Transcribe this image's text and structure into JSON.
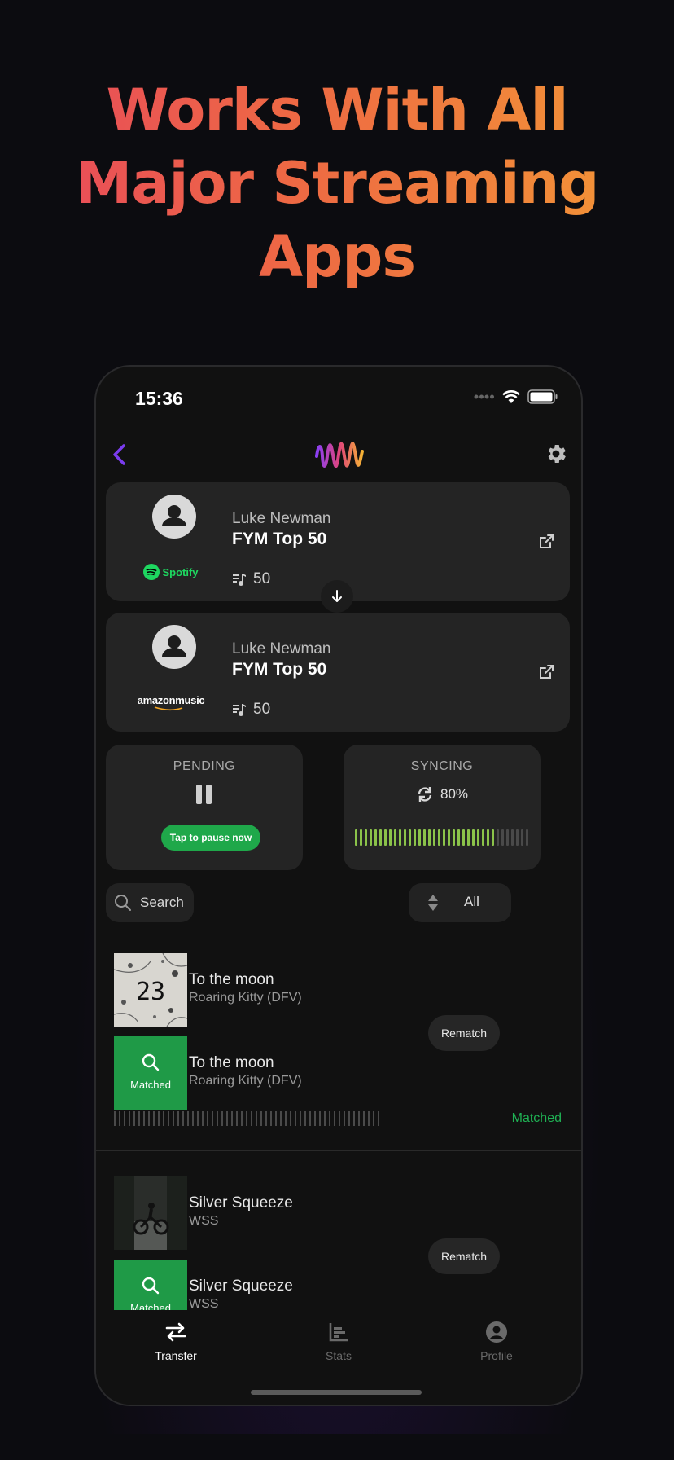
{
  "headline": [
    "Works With All",
    "Major Streaming",
    "Apps"
  ],
  "status_bar": {
    "time": "15:36"
  },
  "source": {
    "owner": "Luke Newman",
    "playlist": "FYM Top 50",
    "count": "50",
    "service": "Spotify"
  },
  "destination": {
    "owner": "Luke Newman",
    "playlist": "FYM Top 50",
    "count": "50",
    "service": "amazonmusic"
  },
  "pending": {
    "title": "PENDING",
    "button": "Tap to pause now"
  },
  "syncing": {
    "title": "SYNCING",
    "percent": "80%",
    "progress": 0.8
  },
  "search": {
    "placeholder": "Search"
  },
  "filter": {
    "label": "All"
  },
  "tracks": [
    {
      "original": {
        "title": "To the moon",
        "artist": "Roaring Kitty (DFV)",
        "art_text": "23"
      },
      "matched": {
        "title": "To the moon",
        "artist": "Roaring Kitty (DFV)",
        "badge": "Matched"
      },
      "rematch": "Rematch",
      "status": "Matched"
    },
    {
      "original": {
        "title": "Silver Squeeze",
        "artist": "WSS"
      },
      "matched": {
        "title": "Silver Squeeze",
        "artist": "WSS",
        "badge": "Matched"
      },
      "rematch": "Rematch"
    }
  ],
  "tabs": [
    {
      "label": "Transfer",
      "active": true
    },
    {
      "label": "Stats",
      "active": false
    },
    {
      "label": "Profile",
      "active": false
    }
  ],
  "colors": {
    "accent_green": "#1fa84a",
    "headline_start": "#e8475d",
    "headline_end": "#f39a35",
    "logo": "#a040f0"
  }
}
